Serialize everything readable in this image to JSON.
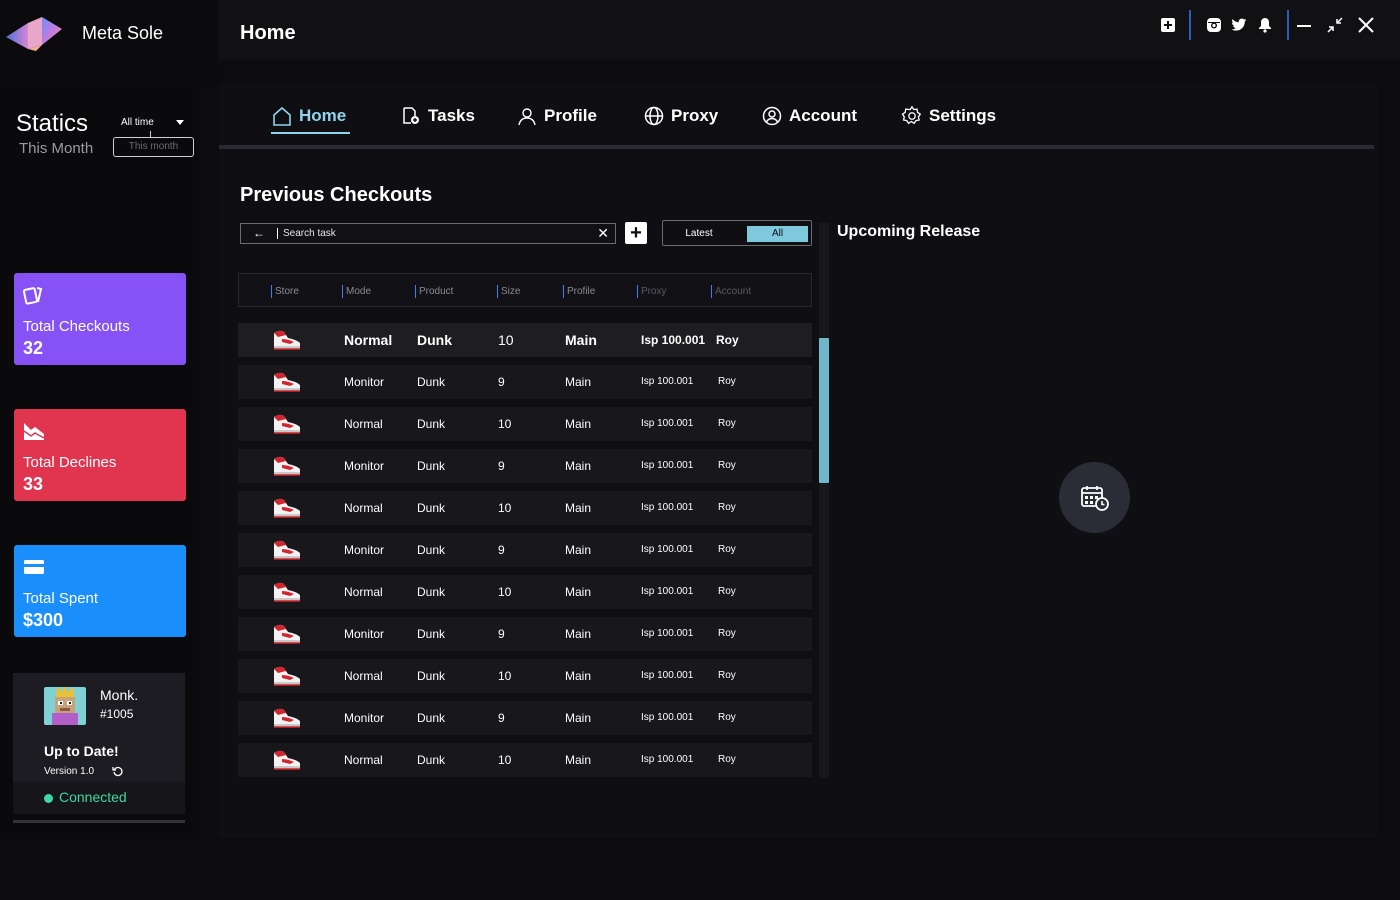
{
  "app": {
    "name": "Meta Sole"
  },
  "header": {
    "title": "Home"
  },
  "window_controls": [
    {
      "name": "add-icon"
    },
    {
      "name": "instagram-icon"
    },
    {
      "name": "twitter-icon"
    },
    {
      "name": "bell-icon"
    },
    {
      "name": "minimize-icon"
    },
    {
      "name": "restore-icon"
    },
    {
      "name": "close-icon"
    }
  ],
  "sidebar": {
    "statics_title": "Statics",
    "statics_subtitle": "This Month",
    "range_selected": "All time",
    "range_option": "This month",
    "cards": [
      {
        "label": "Total Checkouts",
        "value": "32",
        "color": "#8651f5",
        "icon": "cards-icon"
      },
      {
        "label": "Total Declines",
        "value": "33",
        "color": "#e0344f",
        "icon": "trend-down-icon"
      },
      {
        "label": "Total Spent",
        "value": "$300",
        "color": "#1a8ffb",
        "icon": "credit-card-icon"
      }
    ],
    "user": {
      "name": "Monk.",
      "id": "#1005",
      "status": "Up to Date!",
      "version": "Version 1.0",
      "connection": "Connected",
      "connection_color": "#3dd9a0"
    }
  },
  "nav": {
    "tabs": [
      {
        "label": "Home",
        "icon": "home-icon",
        "active": true
      },
      {
        "label": "Tasks",
        "icon": "tasks-icon",
        "active": false
      },
      {
        "label": "Profile",
        "icon": "profile-icon",
        "active": false
      },
      {
        "label": "Proxy",
        "icon": "globe-icon",
        "active": false
      },
      {
        "label": "Account",
        "icon": "account-icon",
        "active": false
      },
      {
        "label": "Settings",
        "icon": "gear-icon",
        "active": false
      }
    ],
    "accent": "#8fd4ec"
  },
  "checkouts": {
    "title": "Previous Checkouts",
    "search_placeholder": "Search task",
    "filter": {
      "latest": "Latest",
      "all": "All",
      "selected": "All"
    },
    "columns": [
      "Store",
      "Mode",
      "Product",
      "Size",
      "Profile",
      "Proxy",
      "Account"
    ],
    "rows": [
      {
        "mode": "Normal",
        "product": "Dunk",
        "size": "10",
        "profile": "Main",
        "proxy": "Isp 100.001",
        "account": "Roy"
      },
      {
        "mode": "Monitor",
        "product": "Dunk",
        "size": "9",
        "profile": "Main",
        "proxy": "Isp 100.001",
        "account": "Roy"
      },
      {
        "mode": "Normal",
        "product": "Dunk",
        "size": "10",
        "profile": "Main",
        "proxy": "Isp 100.001",
        "account": "Roy"
      },
      {
        "mode": "Monitor",
        "product": "Dunk",
        "size": "9",
        "profile": "Main",
        "proxy": "Isp 100.001",
        "account": "Roy"
      },
      {
        "mode": "Normal",
        "product": "Dunk",
        "size": "10",
        "profile": "Main",
        "proxy": "Isp 100.001",
        "account": "Roy"
      },
      {
        "mode": "Monitor",
        "product": "Dunk",
        "size": "9",
        "profile": "Main",
        "proxy": "Isp 100.001",
        "account": "Roy"
      },
      {
        "mode": "Normal",
        "product": "Dunk",
        "size": "10",
        "profile": "Main",
        "proxy": "Isp 100.001",
        "account": "Roy"
      },
      {
        "mode": "Monitor",
        "product": "Dunk",
        "size": "9",
        "profile": "Main",
        "proxy": "Isp 100.001",
        "account": "Roy"
      },
      {
        "mode": "Normal",
        "product": "Dunk",
        "size": "10",
        "profile": "Main",
        "proxy": "Isp 100.001",
        "account": "Roy"
      },
      {
        "mode": "Monitor",
        "product": "Dunk",
        "size": "9",
        "profile": "Main",
        "proxy": "Isp 100.001",
        "account": "Roy"
      },
      {
        "mode": "Normal",
        "product": "Dunk",
        "size": "10",
        "profile": "Main",
        "proxy": "Isp 100.001",
        "account": "Roy"
      }
    ]
  },
  "upcoming": {
    "title": "Upcoming Release",
    "icon": "calendar-clock-icon"
  }
}
